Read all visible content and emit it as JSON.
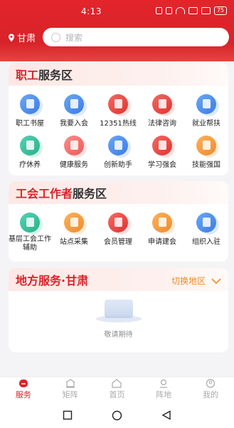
{
  "status_bar": {
    "time": "4:13",
    "battery": "75"
  },
  "header": {
    "location": "甘肃",
    "search_placeholder": "搜索"
  },
  "workers_section": {
    "title_red": "职工",
    "title_dark": "服务区",
    "items": [
      {
        "label": "职工书屋",
        "icon": "book-icon",
        "color": "blue"
      },
      {
        "label": "我要入会",
        "icon": "join-icon",
        "color": "blue"
      },
      {
        "label": "12351热线",
        "icon": "phone-icon",
        "color": "red"
      },
      {
        "label": "法律咨询",
        "icon": "law-icon",
        "color": "red"
      },
      {
        "label": "就业帮扶",
        "icon": "job-icon",
        "color": "blue"
      },
      {
        "label": "疗休养",
        "icon": "palm-tree-icon",
        "color": "green"
      },
      {
        "label": "健康服务",
        "icon": "health-icon",
        "color": "pink"
      },
      {
        "label": "创新助手",
        "icon": "innovation-icon",
        "color": "blue"
      },
      {
        "label": "学习强会",
        "icon": "study-icon",
        "color": "red"
      },
      {
        "label": "技能强国",
        "icon": "skill-icon",
        "color": "orange"
      }
    ]
  },
  "union_section": {
    "title_red": "工会工作者",
    "title_dark": "服务区",
    "items": [
      {
        "label": "基层工会工作辅助",
        "icon": "grassroots-icon",
        "color": "green"
      },
      {
        "label": "站点采集",
        "icon": "station-icon",
        "color": "orange"
      },
      {
        "label": "会员管理",
        "icon": "member-icon",
        "color": "red"
      },
      {
        "label": "申请建会",
        "icon": "apply-icon",
        "color": "orange"
      },
      {
        "label": "组织入驻",
        "icon": "org-icon",
        "color": "blue"
      }
    ]
  },
  "local_section": {
    "title_red": "地方服务·甘肃",
    "switch_label": "切换地区",
    "empty_text": "敬请期待"
  },
  "tabbar": [
    {
      "label": "服务",
      "icon": "service-icon",
      "active": true
    },
    {
      "label": "矩阵",
      "icon": "matrix-icon",
      "active": false
    },
    {
      "label": "首页",
      "icon": "home-icon",
      "active": false
    },
    {
      "label": "阵地",
      "icon": "position-icon",
      "active": false
    },
    {
      "label": "我的",
      "icon": "profile-icon",
      "active": false
    }
  ],
  "colors": {
    "brand_red": "#d8232a",
    "accent_orange": "#f08a2a"
  }
}
